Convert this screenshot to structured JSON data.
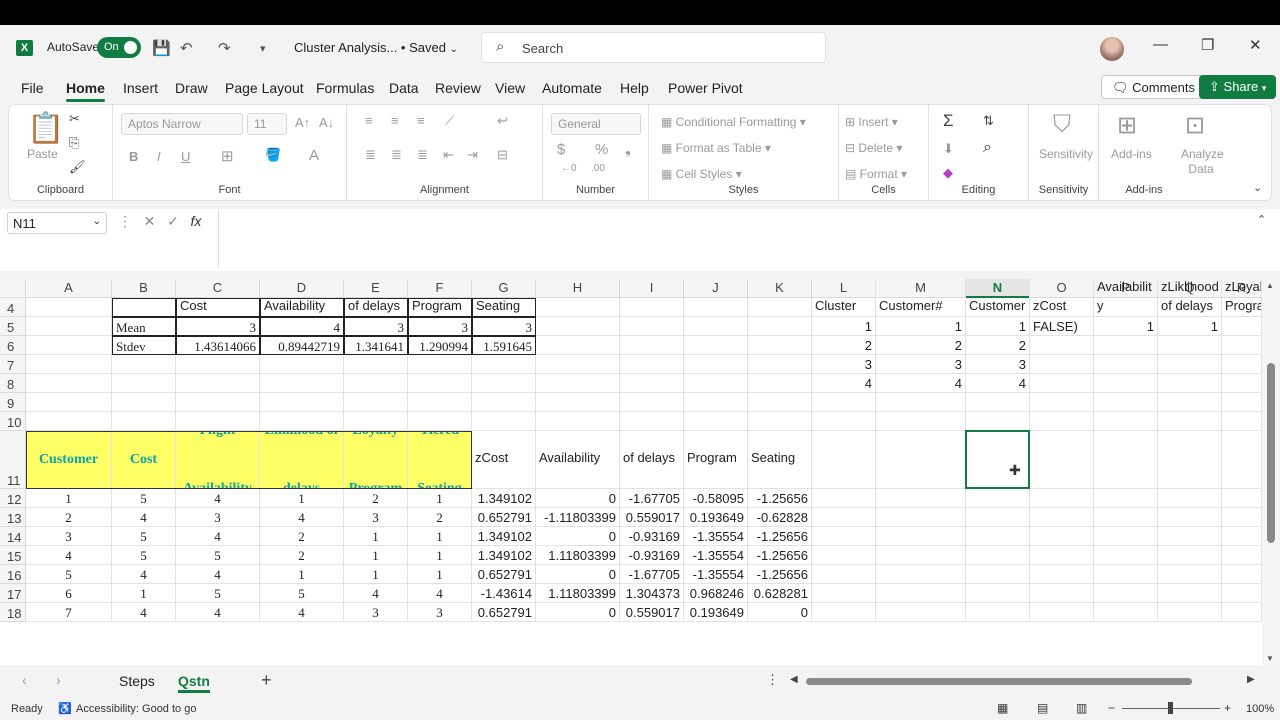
{
  "titlebar": {
    "autosave_label": "AutoSave",
    "autosave_state": "On",
    "doc_title": "Cluster Analysis... • Saved",
    "search_placeholder": "Search"
  },
  "menu": {
    "tabs": [
      "File",
      "Home",
      "Insert",
      "Draw",
      "Page Layout",
      "Formulas",
      "Data",
      "Review",
      "View",
      "Automate",
      "Help",
      "Power Pivot"
    ],
    "active": "Home",
    "comments": "Comments",
    "share": "Share"
  },
  "ribbon": {
    "clipboard": {
      "label": "Clipboard",
      "paste": "Paste"
    },
    "font": {
      "label": "Font",
      "name": "Aptos Narrow",
      "size": "11"
    },
    "alignment": {
      "label": "Alignment"
    },
    "number": {
      "label": "Number",
      "format": "General"
    },
    "styles": {
      "label": "Styles",
      "conditional": "Conditional Formatting",
      "table": "Format as Table",
      "cell_styles": "Cell Styles"
    },
    "cells": {
      "label": "Cells",
      "insert": "Insert",
      "delete": "Delete",
      "format": "Format"
    },
    "editing": {
      "label": "Editing"
    },
    "sensitivity": {
      "label": "Sensitivity",
      "btn": "Sensitivity"
    },
    "addins": {
      "label": "Add-ins",
      "btn": "Add-ins",
      "analyze": "Analyze Data"
    }
  },
  "formula_bar": {
    "name_box": "N11",
    "formula": ""
  },
  "columns": [
    "A",
    "B",
    "C",
    "D",
    "E",
    "F",
    "G",
    "H",
    "I",
    "J",
    "K",
    "L",
    "M",
    "N",
    "O",
    "P",
    "Q",
    "R"
  ],
  "selected_column": "N",
  "rows": [
    "4",
    "5",
    "6",
    "7",
    "8",
    "9",
    "10",
    "11",
    "12",
    "13",
    "14",
    "15",
    "16",
    "17",
    "18"
  ],
  "stats": {
    "headers": [
      "Cost",
      "Flight Availability",
      "Liklihood of delays",
      "Loyalty Program",
      "Tiered Seating"
    ],
    "mean_label": "Mean",
    "mean": [
      "3",
      "4",
      "3",
      "3",
      "3"
    ],
    "stdev_label": "Stdev",
    "stdev": [
      "1.43614066",
      "0.89442719",
      "1.341641",
      "1.290994",
      "1.591645"
    ]
  },
  "right_table": {
    "headers": [
      "Cluster",
      "Customer#",
      "Customer",
      "zCost",
      "Availabilit y",
      "zLiklihood of delays",
      "zLoyal Progra"
    ],
    "rows": [
      [
        "1",
        "1",
        "1",
        "FALSE)",
        "1",
        "1"
      ],
      [
        "2",
        "2",
        "2"
      ],
      [
        "3",
        "3",
        "3"
      ],
      [
        "4",
        "4",
        "4"
      ]
    ]
  },
  "data_table": {
    "headers": [
      "Customer",
      "Cost",
      "Flight Availability",
      "Liklihood of delays",
      "Loyalty Program",
      "Tiered Seating"
    ],
    "z_headers": [
      "zCost",
      "zFlight Availability",
      "zLiklihood of delays",
      "zLoyalty Program",
      "zTiered Seating"
    ],
    "rows": [
      [
        "1",
        "5",
        "4",
        "1",
        "2",
        "1",
        "1.349102",
        "0",
        "-1.67705",
        "-0.58095",
        "-1.25656"
      ],
      [
        "2",
        "4",
        "3",
        "4",
        "3",
        "2",
        "0.652791",
        "-1.11803399",
        "0.559017",
        "0.193649",
        "-0.62828"
      ],
      [
        "3",
        "5",
        "4",
        "2",
        "1",
        "1",
        "1.349102",
        "0",
        "-0.93169",
        "-1.35554",
        "-1.25656"
      ],
      [
        "4",
        "5",
        "5",
        "2",
        "1",
        "1",
        "1.349102",
        "1.11803399",
        "-0.93169",
        "-1.35554",
        "-1.25656"
      ],
      [
        "5",
        "4",
        "4",
        "1",
        "1",
        "1",
        "0.652791",
        "0",
        "-1.67705",
        "-1.35554",
        "-1.25656"
      ],
      [
        "6",
        "1",
        "5",
        "5",
        "4",
        "4",
        "-1.43614",
        "1.11803399",
        "1.304373",
        "0.968246",
        "0.628281"
      ],
      [
        "7",
        "4",
        "4",
        "4",
        "3",
        "3",
        "0.652791",
        "0",
        "0.559017",
        "0.193649",
        "0"
      ]
    ]
  },
  "sheets": {
    "tabs": [
      "Steps",
      "Qstn"
    ],
    "active": "Qstn"
  },
  "status": {
    "ready": "Ready",
    "accessibility": "Accessibility: Good to go",
    "zoom": "100%"
  }
}
